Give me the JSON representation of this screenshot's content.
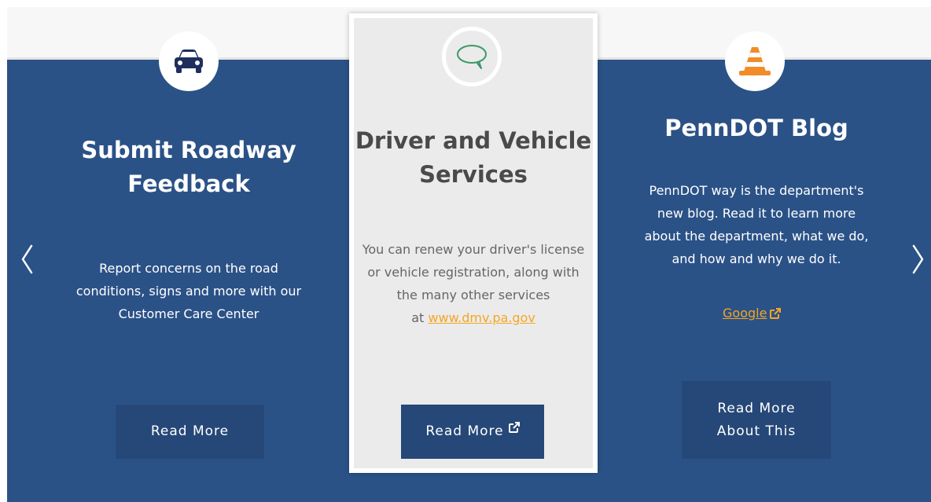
{
  "colors": {
    "band": "#2b5287",
    "button": "#264878",
    "link": "#f5a623",
    "card_mid": "#ebebeb",
    "icon_car": "#1e2f5e",
    "icon_chat": "#3c9a63",
    "icon_cone": "#f28c28"
  },
  "carousel": {
    "prev_icon": "chevron-left-icon",
    "next_icon": "chevron-right-icon"
  },
  "cards": [
    {
      "icon": "car-icon",
      "title_line1": "Submit Roadway",
      "title_line2": "Feedback",
      "desc_line1": "Report concerns on the road",
      "desc_line2": "conditions, signs and more with our",
      "desc_line3": "Customer Care Center",
      "button": "Read More"
    },
    {
      "icon": "speech-bubble-icon",
      "title_line1": "Driver and Vehicle",
      "title_line2": "Services",
      "desc_line1": "You can renew your driver's license",
      "desc_line2": "or vehicle registration, along with",
      "desc_line3": "the many other services",
      "desc_prefix": "at ",
      "desc_link": "www.dmv.pa.gov",
      "button": "Read More"
    },
    {
      "icon": "traffic-cone-icon",
      "title": "PennDOT Blog",
      "desc_line1": "PennDOT way is the department's",
      "desc_line2": "new blog. Read it to learn more",
      "desc_line3": "about the department, what we do,",
      "desc_line4": "and how and why we do it.",
      "link": "Google",
      "button_line1": "Read More",
      "button_line2": "About This"
    }
  ]
}
